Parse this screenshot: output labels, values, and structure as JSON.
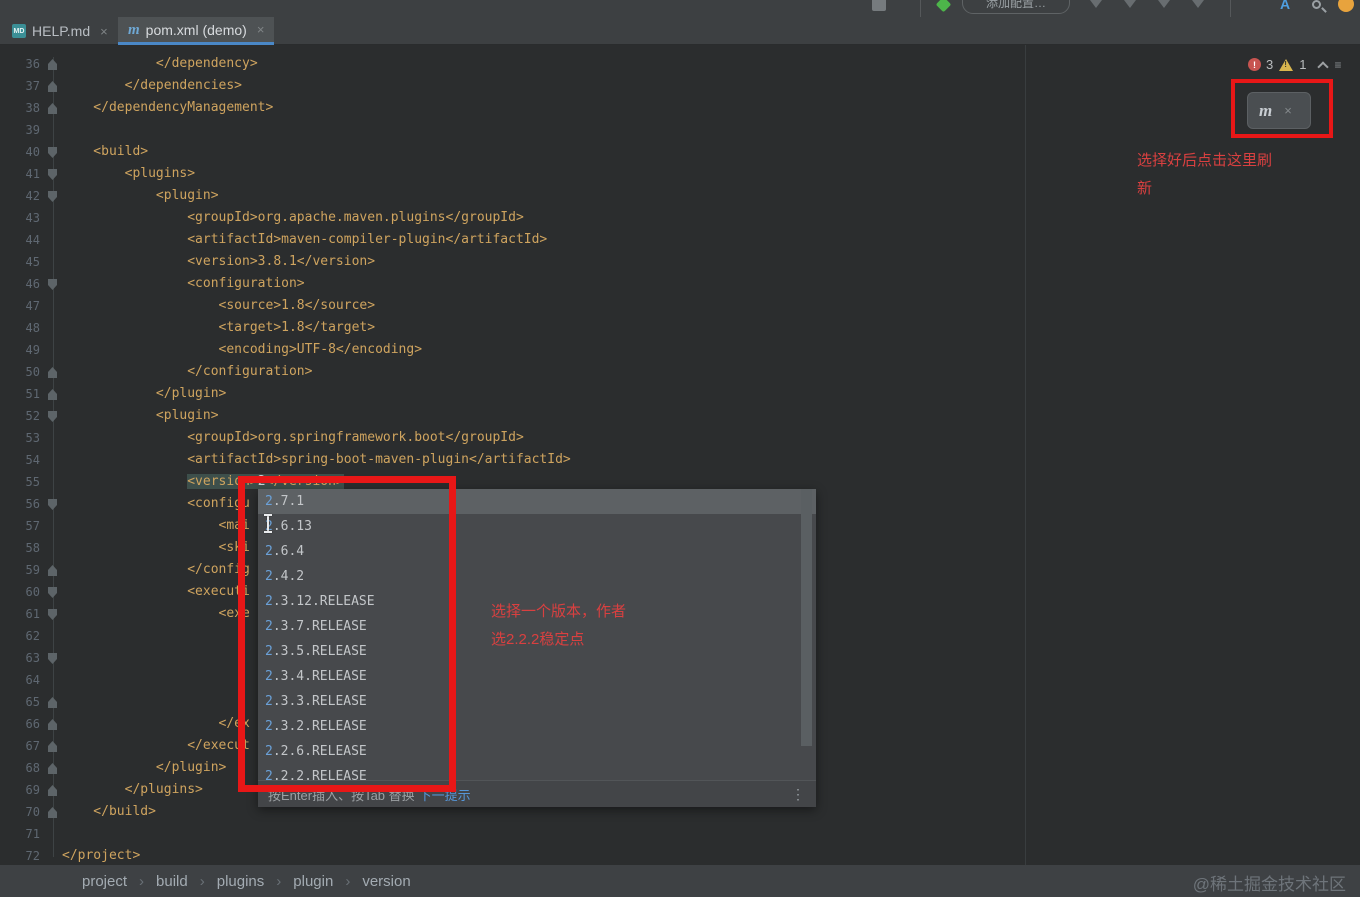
{
  "topbar": {
    "run_config_label": "添加配置…"
  },
  "ui": {
    "close_glyph": "×",
    "more_glyph": "⋮",
    "menu_glyph": "≡",
    "bang": "!",
    "maven_m": "m",
    "sync_glyph": "↻",
    "md_label": "MD",
    "a_label": "A"
  },
  "tabs": [
    {
      "label": "HELP.md",
      "icon": "markdown-file-icon",
      "active": false
    },
    {
      "label": "pom.xml (demo)",
      "icon": "maven-file-icon",
      "active": true
    }
  ],
  "inspections": {
    "errors": "3",
    "warnings": "1"
  },
  "editor": {
    "caret_line": 55,
    "lines": [
      {
        "n": 36,
        "indent": 3,
        "text": "</dependency>",
        "fold": "e"
      },
      {
        "n": 37,
        "indent": 2,
        "text": "</dependencies>",
        "fold": "e"
      },
      {
        "n": 38,
        "indent": 1,
        "text": "</dependencyManagement>",
        "fold": "e"
      },
      {
        "n": 39,
        "indent": 0,
        "text": "",
        "fold": ""
      },
      {
        "n": 40,
        "indent": 1,
        "text": "<build>",
        "fold": "s"
      },
      {
        "n": 41,
        "indent": 2,
        "text": "<plugins>",
        "fold": "s"
      },
      {
        "n": 42,
        "indent": 3,
        "text": "<plugin>",
        "fold": "s"
      },
      {
        "n": 43,
        "indent": 4,
        "text": "<groupId>org.apache.maven.plugins</groupId>",
        "fold": ""
      },
      {
        "n": 44,
        "indent": 4,
        "text": "<artifactId>maven-compiler-plugin</artifactId>",
        "fold": ""
      },
      {
        "n": 45,
        "indent": 4,
        "text": "<version>3.8.1</version>",
        "fold": ""
      },
      {
        "n": 46,
        "indent": 4,
        "text": "<configuration>",
        "fold": "s"
      },
      {
        "n": 47,
        "indent": 5,
        "text": "<source>1.8</source>",
        "fold": ""
      },
      {
        "n": 48,
        "indent": 5,
        "text": "<target>1.8</target>",
        "fold": ""
      },
      {
        "n": 49,
        "indent": 5,
        "text": "<encoding>UTF-8</encoding>",
        "fold": ""
      },
      {
        "n": 50,
        "indent": 4,
        "text": "</configuration>",
        "fold": "e"
      },
      {
        "n": 51,
        "indent": 3,
        "text": "</plugin>",
        "fold": "e"
      },
      {
        "n": 52,
        "indent": 3,
        "text": "<plugin>",
        "fold": "s"
      },
      {
        "n": 53,
        "indent": 4,
        "text": "<groupId>org.springframework.boot</groupId>",
        "fold": ""
      },
      {
        "n": 54,
        "indent": 4,
        "text": "<artifactId>spring-boot-maven-plugin</artifactId>",
        "fold": ""
      },
      {
        "n": 55,
        "indent": 4,
        "pre": "<version>",
        "caret_ch": "2",
        "post": "</version>",
        "highlight": true,
        "fold": ""
      },
      {
        "n": 56,
        "indent": 4,
        "text": "<configu",
        "fold": "s"
      },
      {
        "n": 57,
        "indent": 5,
        "text": "<mai",
        "fold": ""
      },
      {
        "n": 58,
        "indent": 5,
        "text": "<ski",
        "fold": ""
      },
      {
        "n": 59,
        "indent": 4,
        "text": "</config",
        "fold": "e"
      },
      {
        "n": 60,
        "indent": 4,
        "text": "<executi",
        "fold": "s"
      },
      {
        "n": 61,
        "indent": 5,
        "text": "<exe",
        "fold": "s"
      },
      {
        "n": 62,
        "indent": 0,
        "text": "",
        "fold": ""
      },
      {
        "n": 63,
        "indent": 0,
        "text": "",
        "fold": "s"
      },
      {
        "n": 64,
        "indent": 0,
        "text": "",
        "fold": ""
      },
      {
        "n": 65,
        "indent": 0,
        "text": "",
        "fold": "e"
      },
      {
        "n": 66,
        "indent": 5,
        "text": "</ex",
        "fold": "e"
      },
      {
        "n": 67,
        "indent": 4,
        "text": "</execut",
        "fold": "e"
      },
      {
        "n": 68,
        "indent": 3,
        "text": "</plugin>",
        "fold": "e"
      },
      {
        "n": 69,
        "indent": 2,
        "text": "</plugins>",
        "fold": "e"
      },
      {
        "n": 70,
        "indent": 1,
        "text": "</build>",
        "fold": "e"
      },
      {
        "n": 71,
        "indent": 0,
        "text": "",
        "fold": ""
      },
      {
        "n": 72,
        "indent": 0,
        "text": "</project>",
        "fold": ""
      }
    ]
  },
  "completion": {
    "items": [
      {
        "match": "2",
        "rest": ".7.1",
        "selected": true
      },
      {
        "match": "2",
        "rest": ".6.13",
        "selected": false
      },
      {
        "match": "2",
        "rest": ".6.4",
        "selected": false
      },
      {
        "match": "2",
        "rest": ".4.2",
        "selected": false
      },
      {
        "match": "2",
        "rest": ".3.12.RELEASE",
        "selected": false
      },
      {
        "match": "2",
        "rest": ".3.7.RELEASE",
        "selected": false
      },
      {
        "match": "2",
        "rest": ".3.5.RELEASE",
        "selected": false
      },
      {
        "match": "2",
        "rest": ".3.4.RELEASE",
        "selected": false
      },
      {
        "match": "2",
        "rest": ".3.3.RELEASE",
        "selected": false
      },
      {
        "match": "2",
        "rest": ".3.2.RELEASE",
        "selected": false
      },
      {
        "match": "2",
        "rest": ".2.6.RELEASE",
        "selected": false
      },
      {
        "match": "2",
        "rest": ".2.2.RELEASE",
        "selected": false
      }
    ],
    "hint_prefix": "按Enter插入、按Tab 替换",
    "hint_link": "下一提示"
  },
  "annotations": {
    "reload_note_line1": "选择好后点击这里刷",
    "reload_note_line2": "新",
    "version_note_line1": "选择一个版本，作者",
    "version_note_line2": "选2.2.2稳定点"
  },
  "breadcrumbs": [
    "project",
    "build",
    "plugins",
    "plugin",
    "version"
  ],
  "breadcrumb_sep": "›",
  "watermark": "@稀土掘金技术社区",
  "colors": {
    "editor_bg": "#2b2d2e",
    "bar_bg": "#3d4042",
    "active_tab_underline": "#4a88c7",
    "code_text": "#cfa45f",
    "completion_match": "#6ba1d8",
    "annotation_red": "#e81717",
    "note_red": "#d94040",
    "error_badge": "#c75450",
    "warning_badge": "#d8b64e"
  }
}
